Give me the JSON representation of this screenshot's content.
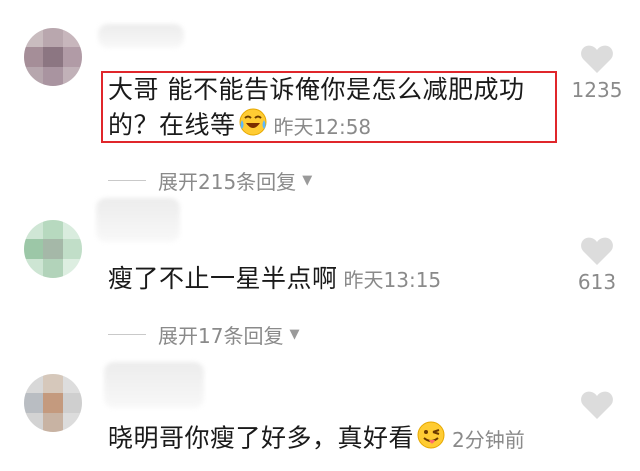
{
  "comments": [
    {
      "text": "大哥 能不能告诉俺你是怎么减肥成功",
      "text_line2": "的？在线等",
      "time": "昨天12:58",
      "likes": "1235",
      "emoji": "laughing-tears-emoji",
      "replies_label": "展开215条回复",
      "highlighted": true
    },
    {
      "text": "瘦了不止一星半点啊",
      "time": "昨天13:15",
      "likes": "613",
      "replies_label": "展开17条回复"
    },
    {
      "text": "晓明哥你瘦了好多，真好看",
      "time": "2分钟前",
      "emoji": "wink-tongue-emoji"
    }
  ],
  "colors": {
    "highlight_border": "#e0262b",
    "secondary_text": "#8a8a8a",
    "heart": "#dcdcdc"
  }
}
